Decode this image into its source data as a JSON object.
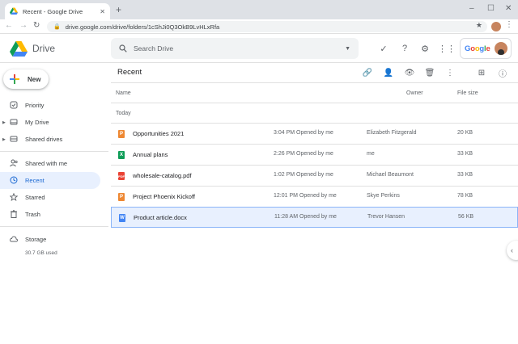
{
  "browser": {
    "tab_title": "Recent - Google Drive",
    "new_tab": "+",
    "url": "drive.google.com/drive/folders/1cShJi0Q3OkB9LvHLxRfa"
  },
  "header": {
    "app_name": "Drive",
    "search_placeholder": "Search Drive",
    "google_label": "Google"
  },
  "sidebar": {
    "new_label": "New",
    "items": [
      {
        "label": "Priority",
        "icon": "priority-icon"
      },
      {
        "label": "My Drive",
        "icon": "my-drive-icon"
      },
      {
        "label": "Shared drives",
        "icon": "shared-drives-icon"
      },
      {
        "label": "Shared with me",
        "icon": "shared-with-me-icon"
      },
      {
        "label": "Recent",
        "icon": "clock-icon"
      },
      {
        "label": "Starred",
        "icon": "star-icon"
      },
      {
        "label": "Trash",
        "icon": "trash-icon"
      },
      {
        "label": "Storage",
        "icon": "cloud-icon"
      }
    ],
    "storage_used": "30.7 GB used"
  },
  "main": {
    "title": "Recent",
    "columns": {
      "name": "Name",
      "owner": "Owner",
      "size": "File size"
    },
    "group": "Today",
    "files": [
      {
        "name": "Opportunities 2021",
        "type": "slides",
        "date": "3:04 PM Opened by me",
        "owner": "Elizabeth Fitzgerald",
        "size": "20 KB"
      },
      {
        "name": "Annual plans",
        "type": "sheets",
        "date": "2:26 PM Opened by me",
        "owner": "me",
        "size": "33 KB"
      },
      {
        "name": "wholesale-catalog.pdf",
        "type": "pdf",
        "date": "1:02 PM Opened by me",
        "owner": "Michael Beaumont",
        "size": "33 KB"
      },
      {
        "name": "Project Phoenix Kickoff",
        "type": "slides",
        "date": "12:01 PM Opened by me",
        "owner": "Skye Perkins",
        "size": "78 KB"
      },
      {
        "name": "Product article.docx",
        "type": "docs",
        "date": "11:28 AM Opened by me",
        "owner": "Trevor Hansen",
        "size": "56 KB"
      }
    ]
  },
  "colors": {
    "slides": "#f4b400",
    "slides_dark": "#ee8833",
    "sheets": "#0f9d58",
    "pdf": "#ea4335",
    "docs": "#4285f4",
    "accent": "#1967d2",
    "selected_bg": "#e8f0fe"
  }
}
